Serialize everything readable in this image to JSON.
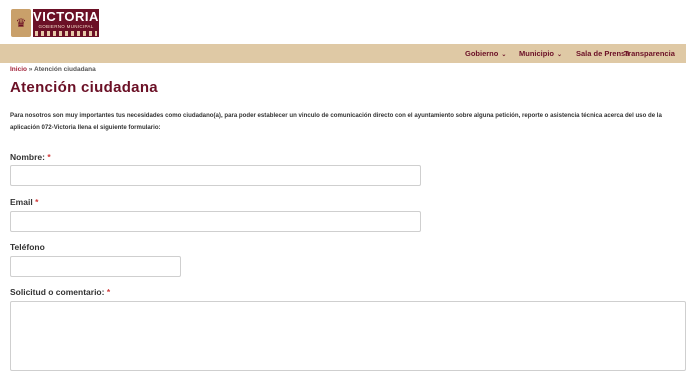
{
  "header": {
    "logo": {
      "name": "VICTORIA",
      "subtitle": "GOBIERNO MUNICIPAL"
    }
  },
  "nav": {
    "items": [
      {
        "label": "Gobierno"
      },
      {
        "label": "Municipio"
      },
      {
        "label": "Sala de Prensa"
      },
      {
        "label": "Transparencia"
      }
    ]
  },
  "breadcrumb": {
    "home": "Inicio",
    "separator": "»",
    "current": "Atención ciudadana"
  },
  "page": {
    "title": "Atención ciudadana",
    "intro": "Para nosotros son muy importantes tus necesidades como ciudadano(a), para poder establecer un vinculo de comunicación directo con el ayuntamiento sobre alguna petición, reporte o asistencia técnica acerca del uso de la aplicación 072-Victoria llena el siguiente formulario:"
  },
  "form": {
    "required_mark": "*",
    "nombre": {
      "label": "Nombre:",
      "value": ""
    },
    "email": {
      "label": "Email",
      "value": ""
    },
    "telefono": {
      "label": "Teléfono",
      "value": ""
    },
    "solicitud": {
      "label": "Solicitud o comentario:",
      "value": ""
    }
  },
  "colors": {
    "brand": "#6b1026",
    "nav_bg": "#dfc9a5",
    "required": "#d23b3b"
  }
}
